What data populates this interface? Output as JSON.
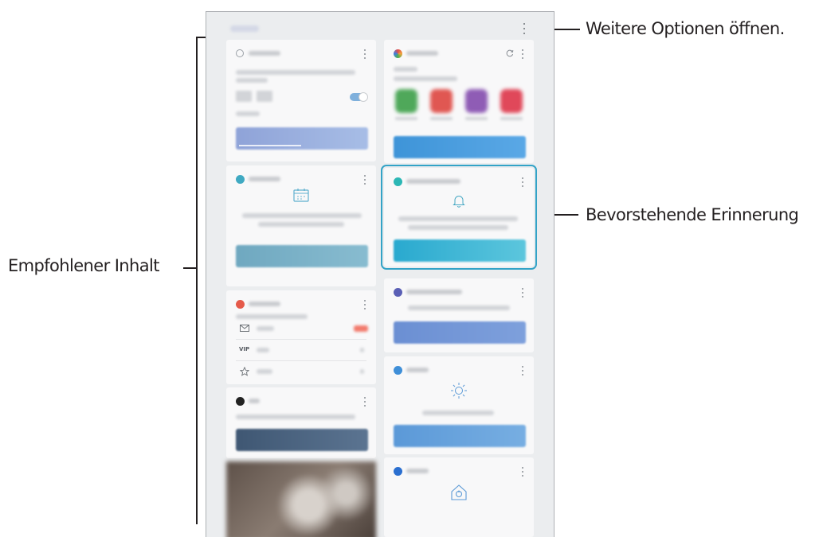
{
  "callouts": {
    "more_options": "Weitere Optionen öffnen.",
    "upcoming_reminder": "Bevorstehende Erinnerung",
    "recommended_content": "Empfohlener Inhalt"
  },
  "colors": {
    "callout_line": "#231f20",
    "highlight": "#33a3c7",
    "panel_bg": "#ebedef",
    "card_bg": "#f8f8f9"
  },
  "icons": {
    "more_options": "more-vert-icon",
    "calendar": "calendar-icon",
    "bell": "bell-icon",
    "mail": "mail-icon",
    "star": "star-icon",
    "sun": "sun-icon",
    "home": "home-icon",
    "refresh": "refresh-icon"
  },
  "email_rows": {
    "vip_label": "VIP"
  }
}
